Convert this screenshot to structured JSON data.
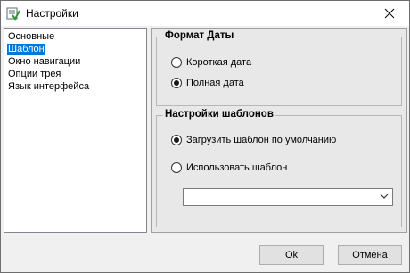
{
  "window": {
    "title": "Настройки"
  },
  "nav": {
    "items": [
      {
        "label": "Основные"
      },
      {
        "label": "Шаблон",
        "selected": true
      },
      {
        "label": "Окно навигации"
      },
      {
        "label": "Опции трея"
      },
      {
        "label": "Язык интерфейса"
      }
    ]
  },
  "date_format": {
    "title": "Формат Даты",
    "options": [
      {
        "label": "Короткая дата",
        "checked": false
      },
      {
        "label": "Полная дата",
        "checked": true
      }
    ]
  },
  "template_settings": {
    "title": "Настройки шаблонов",
    "options": [
      {
        "label": "Загрузить шаблон по умолчанию",
        "checked": true
      },
      {
        "label": "Использовать шаблон",
        "checked": false
      }
    ],
    "template_select_value": ""
  },
  "buttons": {
    "ok": "Ok",
    "cancel": "Отмена"
  },
  "colors": {
    "selection": "#0078d7"
  }
}
